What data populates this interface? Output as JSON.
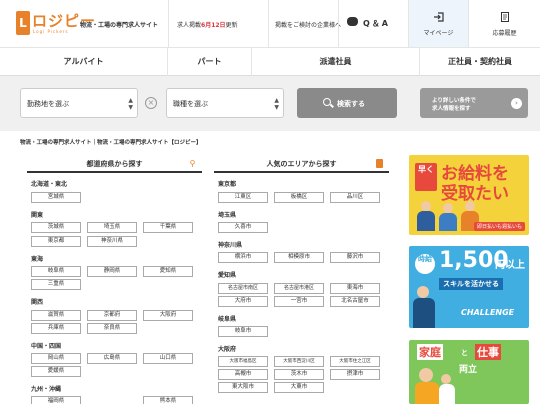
{
  "header": {
    "logo_text": "ロジピー",
    "logo_mark": "L",
    "logo_sub": "Logi Pickers",
    "tagline": "物流・工場の専門求人サイト",
    "update_prefix": "求人掲載",
    "update_date": "6月12日",
    "update_suffix": "更新",
    "enterprise_label": "掲載をご検討の企業様へ",
    "qa_label": "Q＆A",
    "mypage_label": "マイページ",
    "history_label": "応募履歴"
  },
  "nav": {
    "items": [
      "アルバイト",
      "パート",
      "派遣社員",
      "正社員・契約社員"
    ]
  },
  "search": {
    "location_placeholder": "勤務地を選ぶ",
    "job_placeholder": "職種を選ぶ",
    "search_label": "検索する",
    "detail_line1": "より詳しい条件で",
    "detail_line2": "求人情報を探す"
  },
  "breadcrumb": "物流・工場の専門求人サイト｜物流・工場の専門求人サイト【ロジピー】",
  "prefecture_panel": {
    "title": "都道府県から探す",
    "regions": [
      {
        "name": "北海道・東北",
        "items": [
          "宮城県"
        ]
      },
      {
        "name": "関東",
        "items": [
          "茨城県",
          "埼玉県",
          "千葉県",
          "東京都",
          "神奈川県"
        ]
      },
      {
        "name": "東海",
        "items": [
          "岐阜県",
          "静岡県",
          "愛知県",
          "三重県"
        ]
      },
      {
        "name": "関西",
        "items": [
          "滋賀県",
          "京都府",
          "大阪府",
          "兵庫県",
          "奈良県"
        ]
      },
      {
        "name": "中国・四国",
        "items": [
          "岡山県",
          "広島県",
          "山口県",
          "愛媛県"
        ]
      },
      {
        "name": "九州・沖縄",
        "items": [
          "福岡県",
          "熊本県"
        ]
      }
    ]
  },
  "area_panel": {
    "title": "人気のエリアから探す",
    "regions": [
      {
        "name": "東京都",
        "items": [
          "江東区",
          "板橋区",
          "品川区"
        ]
      },
      {
        "name": "埼玉県",
        "items": [
          "久喜市"
        ]
      },
      {
        "name": "神奈川県",
        "items": [
          "横浜市",
          "相模原市",
          "藤沢市"
        ]
      },
      {
        "name": "愛知県",
        "items": [
          "名古屋市南区",
          "名古屋市港区",
          "東海市",
          "大府市",
          "一宮市",
          "北名古屋市"
        ]
      },
      {
        "name": "岐阜県",
        "items": [
          "岐阜市"
        ]
      },
      {
        "name": "大阪府",
        "items": [
          "大阪市福島区",
          "大阪市西淀川区",
          "大阪市住之江区",
          "高槻市",
          "茨木市",
          "摂津市",
          "東大阪市",
          "大東市"
        ]
      }
    ]
  },
  "banners": {
    "b1_badge": "早く",
    "b1_line1": "お給料を",
    "b1_line2": "受取たい",
    "b1_tag": "即日払いも週払いも",
    "b2_badge": "時給",
    "b2_number": "1,500",
    "b2_unit": "円以上",
    "b2_skill": "スキルを活かせる",
    "b2_challenge": "CHALLENGE",
    "b3_word1": "家庭",
    "b3_and": "と",
    "b3_word2": "仕事",
    "b3_word3": "両立",
    "accent_orange": "#e8822a",
    "accent_red": "#e74a3c"
  }
}
